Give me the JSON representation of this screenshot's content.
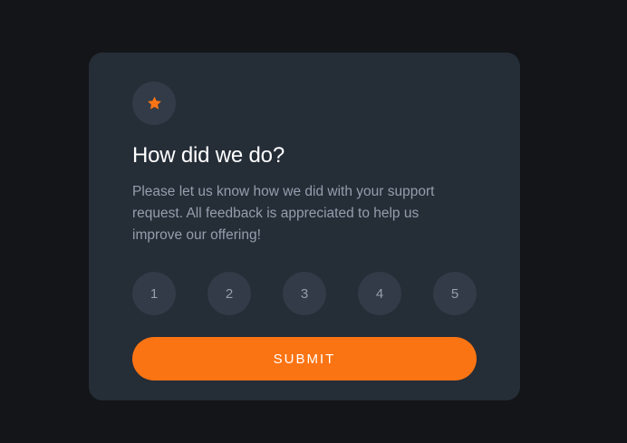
{
  "card": {
    "icon": "star-icon",
    "title": "How did we do?",
    "description": "Please let us know how we did with your support request. All feedback is appreciated to help us improve our offering!",
    "ratings": [
      "1",
      "2",
      "3",
      "4",
      "5"
    ],
    "submit_label": "SUBMIT"
  },
  "colors": {
    "page_background": "#131518",
    "card_background": "#252d37",
    "circle_background": "#323b47",
    "muted_text": "#959eac",
    "accent": "#fb7413",
    "heading": "#ffffff"
  }
}
